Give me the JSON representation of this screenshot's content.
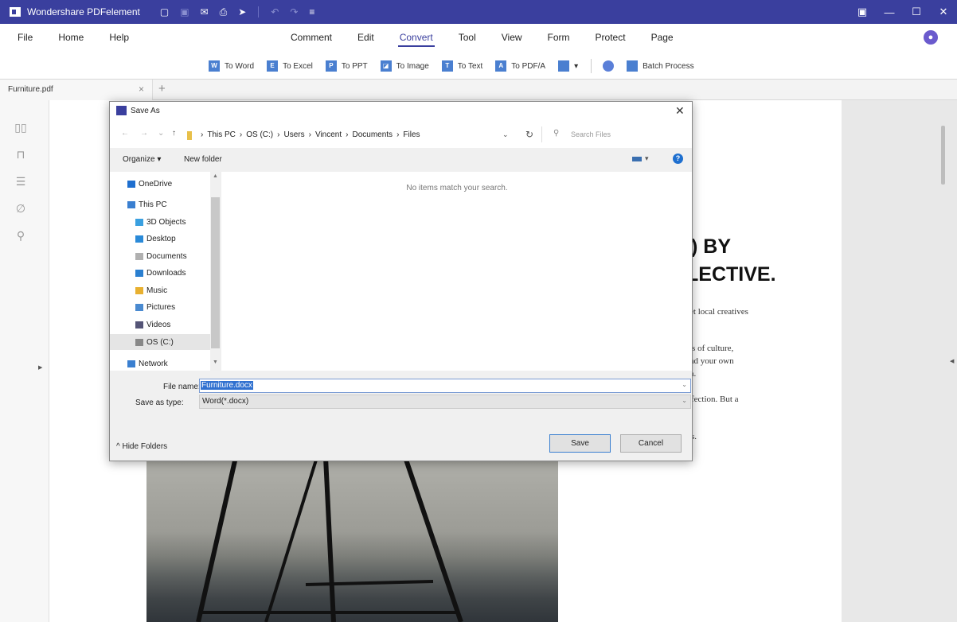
{
  "app": {
    "title": "Wondershare PDFelement"
  },
  "quick_access": [
    "▢",
    "▣",
    "✉",
    "⎙",
    "➤",
    "↶",
    "↷",
    "≡"
  ],
  "window_controls": {
    "restore_panel": "▣",
    "minimize": "—",
    "maximize": "☐",
    "close": "✕"
  },
  "menu_left": [
    "File",
    "Home",
    "Help"
  ],
  "menu_center": [
    "Comment",
    "Edit",
    "Convert",
    "Tool",
    "View",
    "Form",
    "Protect",
    "Page"
  ],
  "active_menu": "Convert",
  "avatar_glyph": "●",
  "ribbon": {
    "items": [
      {
        "icon": "W",
        "label": "To Word"
      },
      {
        "icon": "E",
        "label": "To Excel"
      },
      {
        "icon": "P",
        "label": "To PPT"
      },
      {
        "icon": "◪",
        "label": "To Image"
      },
      {
        "icon": "T",
        "label": "To Text"
      },
      {
        "icon": "A",
        "label": "To PDF/A"
      }
    ],
    "batch_label": "Batch Process"
  },
  "tab": {
    "name": "Furniture.pdf",
    "close": "×",
    "add": "+"
  },
  "document": {
    "headline1": ") BY",
    "headline2": "LECTIVE.",
    "line1": "et local creatives",
    "line2": "ls of culture,",
    "line3": "nd your own",
    "line4": "n.",
    "line5": "fection. But a",
    "line6": "s."
  },
  "dialog": {
    "title": "Save As",
    "close": "✕",
    "path": [
      "This PC",
      "OS (C:)",
      "Users",
      "Vincent",
      "Documents",
      "Files"
    ],
    "search_placeholder": "Search Files",
    "organize": "Organize ▾",
    "new_folder": "New folder",
    "nav": [
      {
        "label": "OneDrive",
        "color": "#1e6fcf"
      },
      {
        "label": "This PC",
        "color": "#3a7fd0"
      },
      {
        "label": "3D Objects",
        "color": "#3aa0e0"
      },
      {
        "label": "Desktop",
        "color": "#2a8ad8"
      },
      {
        "label": "Documents",
        "color": "#b0b0b0"
      },
      {
        "label": "Downloads",
        "color": "#2a7fd0"
      },
      {
        "label": "Music",
        "color": "#e8b030"
      },
      {
        "label": "Pictures",
        "color": "#4a8ad0"
      },
      {
        "label": "Videos",
        "color": "#555577"
      },
      {
        "label": "OS (C:)",
        "color": "#888888"
      },
      {
        "label": "Network",
        "color": "#3a7fd0"
      }
    ],
    "selected_nav": "OS (C:)",
    "empty_message": "No items match your search.",
    "file_name_label": "File name:",
    "file_name": "Furniture.docx",
    "save_type_label": "Save as type:",
    "save_type": "Word(*.docx)",
    "hide_folders": "Hide Folders",
    "save_button": "Save",
    "cancel_button": "Cancel"
  }
}
